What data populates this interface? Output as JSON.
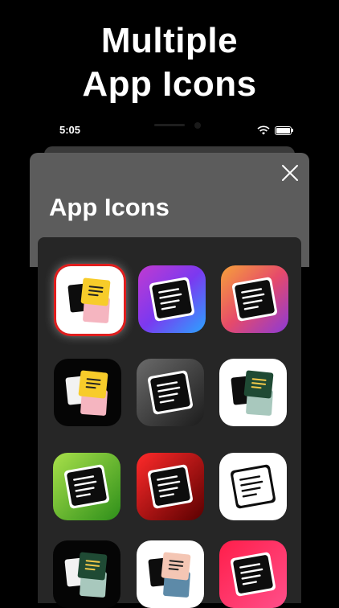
{
  "headline": {
    "line1": "Multiple",
    "line2": "App Icons"
  },
  "status_bar": {
    "time": "5:05"
  },
  "sheet": {
    "title": "App Icons"
  },
  "colors": {
    "accent_selected": "#e01e1e",
    "sheet_bg": "#5c5c5c",
    "panel_bg": "#262626"
  },
  "icons": [
    {
      "id": "sticky-notes-yellow-pink",
      "variant": "stacked-notes",
      "background": "white",
      "selected": true
    },
    {
      "id": "note-purple-blue-gradient",
      "variant": "black-note",
      "background": "purple-blue-gradient",
      "selected": false
    },
    {
      "id": "note-orange-purple-gradient",
      "variant": "black-note",
      "background": "orange-purple-gradient",
      "selected": false
    },
    {
      "id": "sticky-notes-dark",
      "variant": "stacked-notes",
      "background": "black",
      "selected": false
    },
    {
      "id": "note-dark-gray",
      "variant": "black-note",
      "background": "dark-gray",
      "selected": false
    },
    {
      "id": "sticky-notes-green-white",
      "variant": "stacked-notes-green",
      "background": "white",
      "selected": false
    },
    {
      "id": "note-green",
      "variant": "black-note",
      "background": "green",
      "selected": false
    },
    {
      "id": "note-red",
      "variant": "black-note",
      "background": "red",
      "selected": false
    },
    {
      "id": "note-white-outline",
      "variant": "white-note",
      "background": "white",
      "selected": false
    },
    {
      "id": "sticky-notes-green-dark",
      "variant": "stacked-notes-green",
      "background": "black",
      "selected": false
    },
    {
      "id": "sticky-notes-peach-blue",
      "variant": "stacked-notes-peach",
      "background": "white",
      "selected": false
    },
    {
      "id": "note-red-pink",
      "variant": "black-note",
      "background": "red-pink",
      "selected": false
    }
  ]
}
